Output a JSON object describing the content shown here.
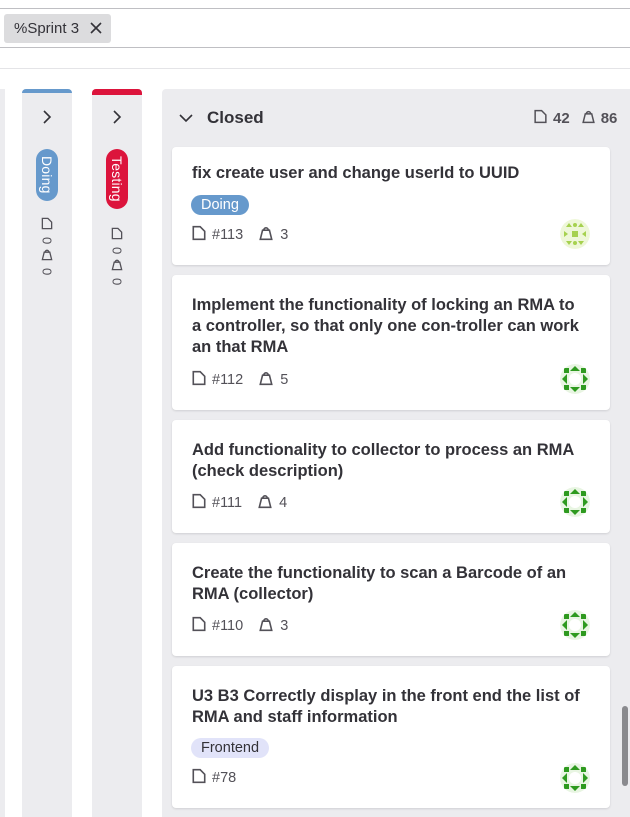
{
  "filter": {
    "token_text": "%Sprint 3",
    "remove_icon": "close-icon"
  },
  "lists": [
    {
      "name": "Doing",
      "color": "#6699cc",
      "issues": "0",
      "weight": "0"
    },
    {
      "name": "Testing",
      "color": "#dc143c",
      "issues": "0",
      "weight": "0"
    }
  ],
  "closed": {
    "title": "Closed",
    "issue_count": "42",
    "weight_total": "86"
  },
  "cards": [
    {
      "title": "fix create user and change userId to UUID",
      "label": "Doing",
      "label_bg": "#6699cc",
      "label_fg": "#ffffff",
      "ref": "#113",
      "weight": "3"
    },
    {
      "title": "Implement the functionality of locking an RMA to a controller, so that only one con-troller can work an that RMA",
      "label": "",
      "ref": "#112",
      "weight": "5"
    },
    {
      "title": "Add functionality to collector to process an RMA (check description)",
      "label": "",
      "ref": "#111",
      "weight": "4"
    },
    {
      "title": "Create the functionality to scan a Barcode of an RMA (collector)",
      "label": "",
      "ref": "#110",
      "weight": "3"
    },
    {
      "title": "U3 B3 Correctly display in the front end the list of RMA and staff information",
      "label": "Frontend",
      "label_bg": "#e1e3f9",
      "label_fg": "#333238",
      "ref": "#78",
      "weight": ""
    }
  ]
}
